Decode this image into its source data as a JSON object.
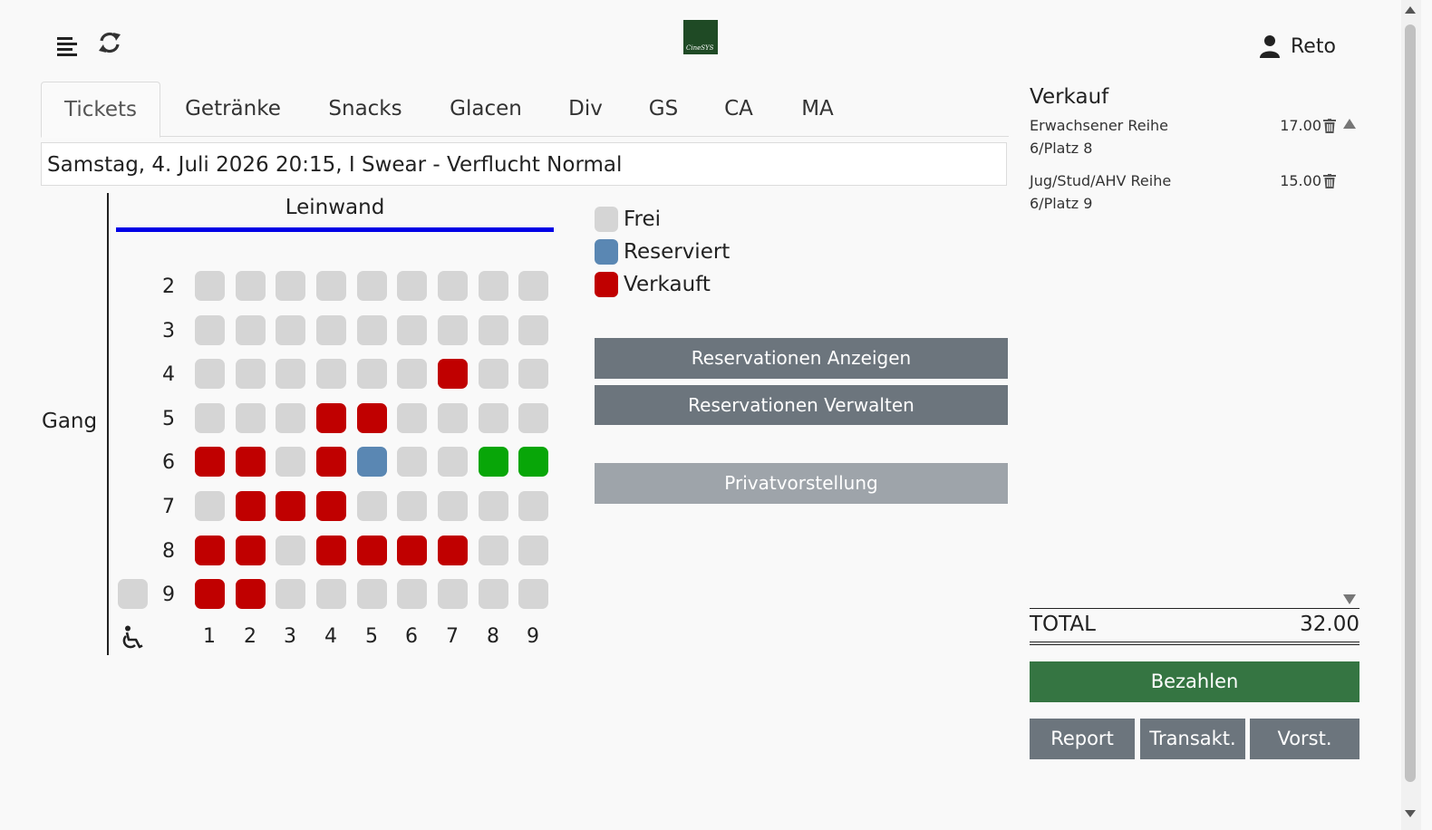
{
  "header": {
    "logo_text": "CineSYS",
    "user_name": "Reto"
  },
  "tabs": [
    {
      "label": "Tickets",
      "active": true
    },
    {
      "label": "Getränke"
    },
    {
      "label": "Snacks"
    },
    {
      "label": "Glacen"
    },
    {
      "label": "Div"
    },
    {
      "label": "GS"
    },
    {
      "label": "CA"
    },
    {
      "label": "MA"
    }
  ],
  "show": {
    "selected": "Samstag, 4. Juli 2026 20:15, I Swear - Verflucht Normal"
  },
  "seatmap": {
    "screen_label": "Leinwand",
    "aisle_label": "Gang",
    "column_labels": [
      "1",
      "2",
      "3",
      "4",
      "5",
      "6",
      "7",
      "8",
      "9"
    ],
    "rows": [
      {
        "label": "2",
        "seats": [
          "F",
          "F",
          "F",
          "F",
          "F",
          "F",
          "F",
          "F",
          "F"
        ]
      },
      {
        "label": "3",
        "seats": [
          "F",
          "F",
          "F",
          "F",
          "F",
          "F",
          "F",
          "F",
          "F"
        ]
      },
      {
        "label": "4",
        "seats": [
          "F",
          "F",
          "F",
          "F",
          "F",
          "F",
          "V",
          "F",
          "F"
        ]
      },
      {
        "label": "5",
        "seats": [
          "F",
          "F",
          "F",
          "V",
          "V",
          "F",
          "F",
          "F",
          "F"
        ]
      },
      {
        "label": "6",
        "seats": [
          "V",
          "V",
          "F",
          "V",
          "R",
          "F",
          "F",
          "S",
          "S"
        ]
      },
      {
        "label": "7",
        "seats": [
          "F",
          "V",
          "V",
          "V",
          "F",
          "F",
          "F",
          "F",
          "F"
        ]
      },
      {
        "label": "8",
        "seats": [
          "V",
          "V",
          "F",
          "V",
          "V",
          "V",
          "V",
          "F",
          "F"
        ]
      },
      {
        "label": "9",
        "seats": [
          "V",
          "V",
          "F",
          "F",
          "F",
          "F",
          "F",
          "F",
          "F"
        ],
        "wheelchair_seat": "F"
      }
    ],
    "wheelchair_icon": "wheelchair-icon",
    "status_colors": {
      "F": "#d5d5d5",
      "R": "#5a87b3",
      "V": "#c00000",
      "S": "#08a608"
    }
  },
  "legend": [
    {
      "label": "Frei",
      "color": "#d5d5d5"
    },
    {
      "label": "Reserviert",
      "color": "#5a87b3"
    },
    {
      "label": "Verkauft",
      "color": "#c00000"
    }
  ],
  "actions": {
    "show_reservations": "Reservationen Anzeigen",
    "manage_reservations": "Reservationen Verwalten",
    "private_show": "Privatvorstellung"
  },
  "sale": {
    "title": "Verkauf",
    "items": [
      {
        "desc": "Erwachsener Reihe 6/Platz 8",
        "price": "17.00"
      },
      {
        "desc": "Jug/Stud/AHV Reihe 6/Platz 9",
        "price": "15.00"
      }
    ],
    "total_label": "TOTAL",
    "total_value": "32.00",
    "pay_button": "Bezahlen",
    "report_button": "Report",
    "transactions_button": "Transakt.",
    "shows_button": "Vorst."
  },
  "colors": {
    "pay_green": "#357542",
    "button_gray": "#6c757d",
    "screen_blue": "#0000e6"
  }
}
